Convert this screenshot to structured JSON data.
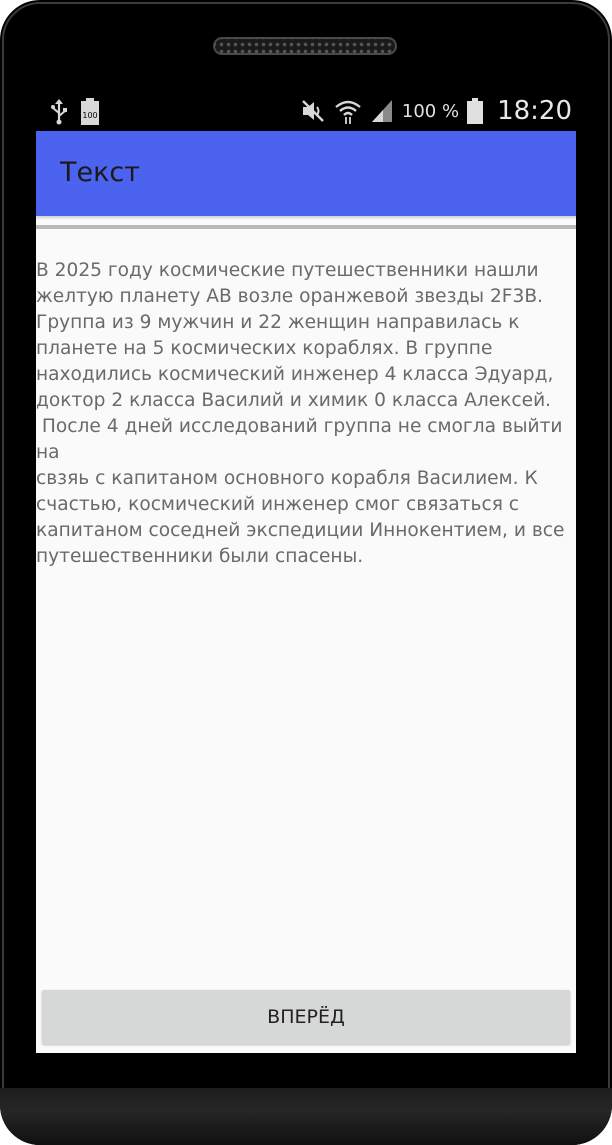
{
  "status_bar": {
    "left_icons": [
      "usb-icon",
      "battery-saver-icon"
    ],
    "battery_saver_text": "100",
    "right_icons": [
      "mute-icon",
      "wifi-icon",
      "signal-icon",
      "battery-icon"
    ],
    "battery_percent": "100 %",
    "time": "18:20"
  },
  "app_bar": {
    "title": "Текст",
    "color": "#4c63f0"
  },
  "story": {
    "text": "В 2025 году космические путешественники нашли\nжелтую планету AB возле оранжевой звезды 2F3B.\nГруппа из 9 мужчин и 22 женщин направилась к\nпланете на 5 космических кораблях. В группе\nнаходились космический инженер 4 класса Эдуард,\nдоктор 2 класса Василий и химик 0 класса Алексей.\n После 4 дней исследований группа не смогла выйти на\nсвзяь с капитаном основного корабля Василием. К\nсчастью, космический инженер смог связаться с\nкапитаном соседней экспедиции Иннокентием, и все\nпутешественники были спасены."
  },
  "next_button": {
    "label": "ВПЕРЁД"
  }
}
